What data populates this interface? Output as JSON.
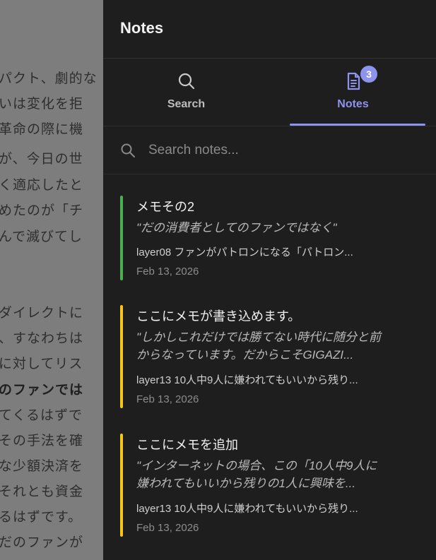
{
  "background": {
    "lines": [
      {
        "text": "パクト、劇的な",
        "bold": false
      },
      {
        "text": "いは変化を拒",
        "bold": false
      },
      {
        "text": "革命の際に機",
        "bold": false
      },
      {
        "text": "が、今日の世",
        "bold": false
      },
      {
        "text": "く適応したと",
        "bold": false
      },
      {
        "text": "めたのが「チ",
        "bold": false
      },
      {
        "text": "んで滅びてし",
        "bold": false
      },
      {
        "text": "ダイレクトに",
        "bold": false
      },
      {
        "text": "、すなわちは",
        "bold": false
      },
      {
        "text": "に対してリス",
        "bold": false
      },
      {
        "text": "のファンでは",
        "bold": true
      },
      {
        "text": "てくるはずで",
        "bold": false
      },
      {
        "text": "その手法を確",
        "bold": false
      },
      {
        "text": "な少額決済を",
        "bold": false
      },
      {
        "text": "それとも資金",
        "bold": false
      },
      {
        "text": "るはずです。",
        "bold": false
      },
      {
        "text": "だのファンが",
        "bold": false
      }
    ]
  },
  "panel": {
    "title": "Notes",
    "tabs": {
      "search": {
        "label": "Search",
        "icon": "search-icon"
      },
      "notes": {
        "label": "Notes",
        "icon": "document-icon",
        "badge": "3"
      }
    },
    "search": {
      "placeholder": "Search notes...",
      "value": ""
    },
    "accent_color": "#8e93ee"
  },
  "notes": [
    {
      "title": "メモその2",
      "quote": "\"だの消費者としてのファンではなく\"",
      "source": "layer08 ファンがパトロンになる「パトロン...",
      "date": "Feb 13, 2026",
      "color": "#4caf50"
    },
    {
      "title": "ここにメモが書き込めます。",
      "quote": "\"しかしこれだけでは勝てない時代に随分と前からなっています。だからこそGIGAZI...",
      "source": "layer13 10人中9人に嫌われてもいいから残り...",
      "date": "Feb 13, 2026",
      "color": "#f5c518"
    },
    {
      "title": "ここにメモを追加",
      "quote": "\"インターネットの場合、この「10人中9人に嫌われてもいいから残りの1人に興味を...",
      "source": "layer13 10人中9人に嫌われてもいいから残り...",
      "date": "Feb 13, 2026",
      "color": "#f5c518"
    }
  ]
}
